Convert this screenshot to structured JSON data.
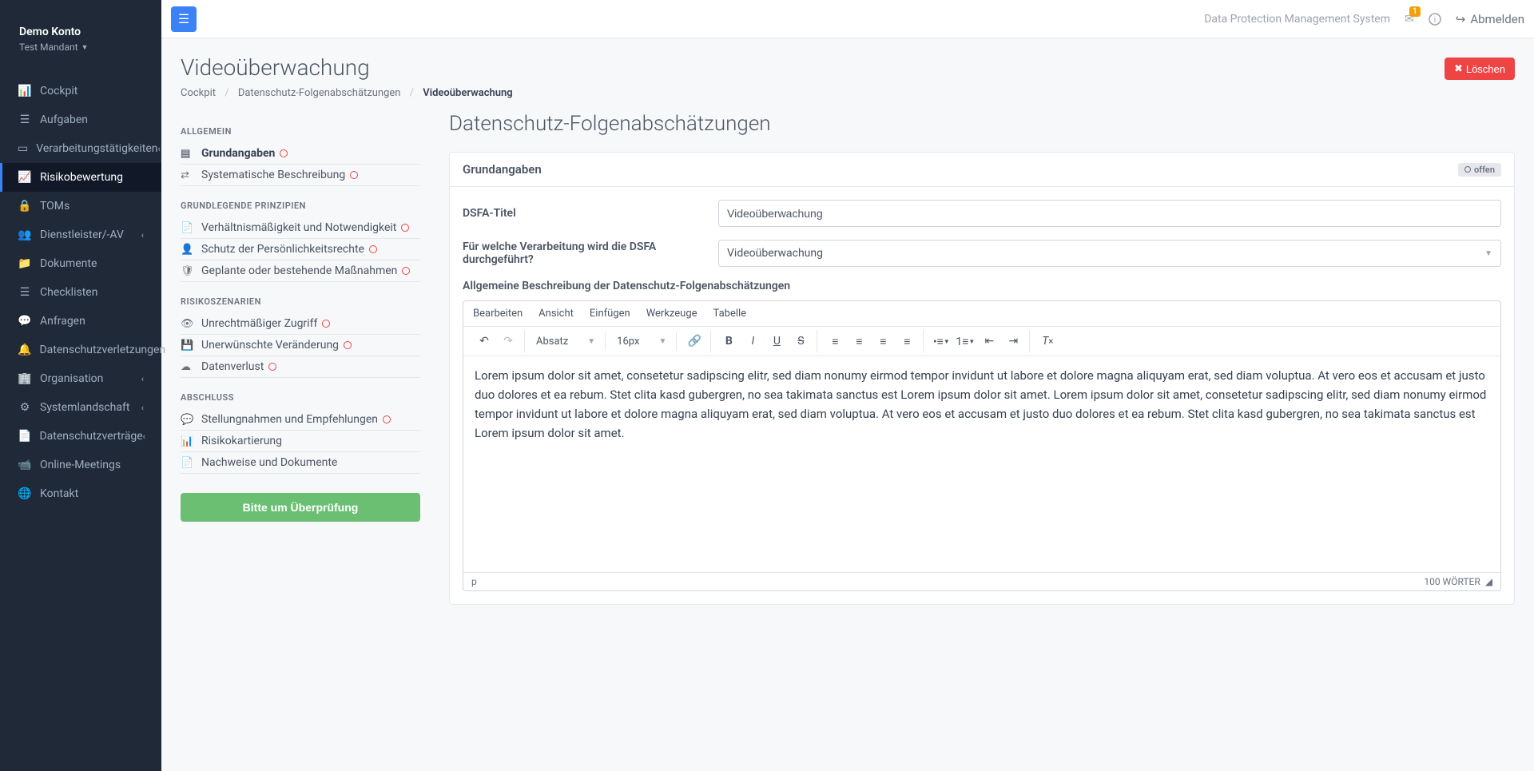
{
  "user": {
    "name": "Demo Konto",
    "tenant": "Test Mandant"
  },
  "topbar": {
    "system_name": "Data Protection Management System",
    "message_count": "1",
    "logout": "Abmelden"
  },
  "sidebar": {
    "items": [
      {
        "label": "Cockpit"
      },
      {
        "label": "Aufgaben"
      },
      {
        "label": "Verarbeitungstätigkeiten",
        "chev": true
      },
      {
        "label": "Risikobewertung",
        "active": true
      },
      {
        "label": "TOMs"
      },
      {
        "label": "Dienstleister/-AV",
        "chev": true
      },
      {
        "label": "Dokumente"
      },
      {
        "label": "Checklisten"
      },
      {
        "label": "Anfragen"
      },
      {
        "label": "Datenschutzverletzungen"
      },
      {
        "label": "Organisation",
        "chev": true
      },
      {
        "label": "Systemlandschaft",
        "chev": true
      },
      {
        "label": "Datenschutzverträge",
        "chev": true
      },
      {
        "label": "Online-Meetings"
      },
      {
        "label": "Kontakt"
      }
    ]
  },
  "page": {
    "title": "Videoüberwachung",
    "breadcrumbs": {
      "c1": "Cockpit",
      "c2": "Datenschutz-Folgenabschätzungen",
      "c3": "Videoüberwachung"
    },
    "delete_label": "Löschen"
  },
  "left": {
    "sections": {
      "allgemein": "ALLGEMEIN",
      "prinzipien": "GRUNDLEGENDE PRINZIPIEN",
      "risiko": "RISIKOSZENARIEN",
      "abschluss": "ABSCHLUSS"
    },
    "items": {
      "grundangaben": "Grundangaben",
      "systematische": "Systematische Beschreibung",
      "verhaeltnis": "Verhältnismäßigkeit und Notwendigkeit",
      "schutz": "Schutz der Persönlichkeitsrechte",
      "geplante": "Geplante oder bestehende Maßnahmen",
      "unrechtmaessig": "Unrechtmäßiger Zugriff",
      "unerwuenscht": "Unerwünschte Veränderung",
      "datenverlust": "Datenverlust",
      "stellungnahmen": "Stellungnahmen und Empfehlungen",
      "risikokartierung": "Risikokartierung",
      "nachweise": "Nachweise und Dokumente"
    },
    "review_button": "Bitte um Überprüfung"
  },
  "form": {
    "title": "Datenschutz-Folgenabschätzungen",
    "panel_title": "Grundangaben",
    "status_badge": "offen",
    "dsfa_titel_label": "DSFA-Titel",
    "dsfa_titel_value": "Videoüberwachung",
    "verarbeitung_label": "Für welche Verarbeitung wird die DSFA durchgeführt?",
    "verarbeitung_value": "Videoüberwachung",
    "desc_label": "Allgemeine Beschreibung der Datenschutz-Folgenabschätzungen",
    "editor_menu": {
      "m1": "Bearbeiten",
      "m2": "Ansicht",
      "m3": "Einfügen",
      "m4": "Werkzeuge",
      "m5": "Tabelle"
    },
    "editor_format": "Absatz",
    "editor_fontsize": "16px",
    "editor_text": "Lorem ipsum dolor sit amet, consetetur sadipscing elitr, sed diam nonumy eirmod tempor invidunt ut labore et dolore magna aliquyam erat, sed diam voluptua. At vero eos et accusam et justo duo dolores et ea rebum. Stet clita kasd gubergren, no sea takimata sanctus est Lorem ipsum dolor sit amet. Lorem ipsum dolor sit amet, consetetur sadipscing elitr, sed diam nonumy eirmod tempor invidunt ut labore et dolore magna aliquyam erat, sed diam voluptua. At vero eos et accusam et justo duo dolores et ea rebum. Stet clita kasd gubergren, no sea takimata sanctus est Lorem ipsum dolor sit amet.",
    "editor_path": "p",
    "word_count": "100 WÖRTER"
  }
}
